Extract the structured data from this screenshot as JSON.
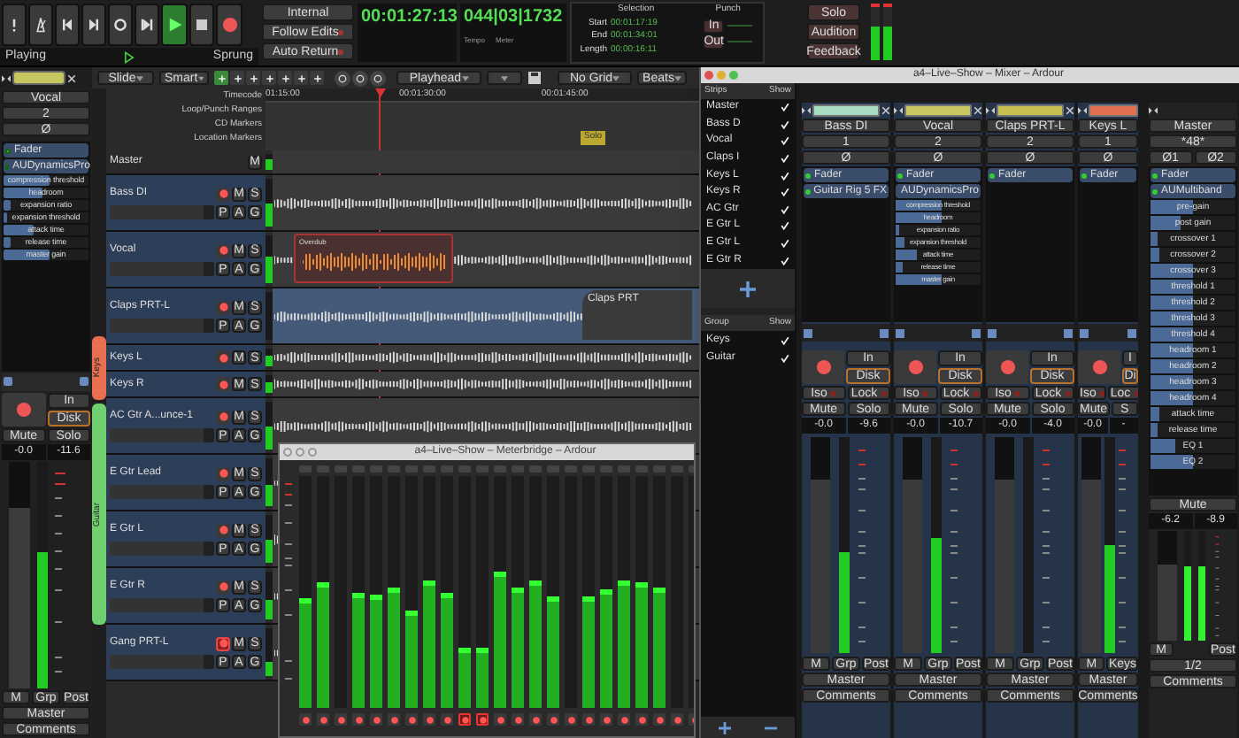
{
  "transport": {
    "state": "Playing",
    "mode": "Sprung",
    "sync_buttons": [
      "Internal",
      "Follow Edits",
      "Auto Return"
    ],
    "primary_clock": "00:01:27:13",
    "secondary_clock": "044|03|1732",
    "tempo_label": "Tempo",
    "meter_label": "Meter",
    "selection": {
      "title": "Selection",
      "rows": [
        {
          "label": "Start",
          "value": "00:01:17:19"
        },
        {
          "label": "End",
          "value": "00:01:34:01"
        },
        {
          "label": "Length",
          "value": "00:00:16:11"
        }
      ]
    },
    "punch": {
      "title": "Punch",
      "buttons": [
        "In",
        "Out"
      ]
    },
    "monitor_buttons": [
      "Solo",
      "Audition",
      "Feedback"
    ]
  },
  "toolbar": {
    "edit_mode": "Slide",
    "tool_mode": "Smart",
    "edit_point": "Playhead",
    "grid": "No Grid",
    "grid_type": "Beats"
  },
  "editor_strip": {
    "name": "Vocal",
    "color": "#c8c860",
    "input": "2",
    "phase": "Ø",
    "processors": [
      "Fader",
      "AUDynamicsPro"
    ],
    "params": [
      {
        "name": "compression threshold",
        "level": 0.55
      },
      {
        "name": "headroom",
        "level": 0.45
      },
      {
        "name": "expansion ratio",
        "level": 0.08
      },
      {
        "name": "expansion threshold",
        "level": 0.05
      },
      {
        "name": "attack time",
        "level": 0.35
      },
      {
        "name": "release time",
        "level": 0.08
      },
      {
        "name": "master gain",
        "level": 0.55
      }
    ],
    "in": "In",
    "disk": "Disk",
    "mute": "Mute",
    "solo": "Solo",
    "gain": "-0.0",
    "peak": "-11.6",
    "fader": {
      "level": 0.8
    },
    "meter": {
      "level": 0.6
    },
    "m": "M",
    "grp": "Grp",
    "post": "Post",
    "output": "Master",
    "comments": "Comments"
  },
  "group_tabs": [
    {
      "name": "Keys",
      "color": "#e87050"
    },
    {
      "name": "Guitar",
      "color": "#70d070"
    }
  ],
  "rulers": [
    "Timecode",
    "Loop/Punch Ranges",
    "CD Markers",
    "Location Markers"
  ],
  "ruler_times": [
    "01:15:00",
    "00:01:30:00",
    "00:01:45:00"
  ],
  "marker": "Solo",
  "tracks": [
    {
      "name": "Master",
      "kind": "master",
      "m": "M",
      "level": 0.7
    },
    {
      "name": "Bass DI",
      "kind": "tall",
      "level": 0.5,
      "rec_armed": false,
      "buttons": [
        "M",
        "S",
        "P",
        "A",
        "G"
      ]
    },
    {
      "name": "Vocal",
      "kind": "tall",
      "level": 0.55,
      "rec_armed": false,
      "buttons": [
        "M",
        "S",
        "P",
        "A",
        "G"
      ],
      "region": "Overdub"
    },
    {
      "name": "Claps PRT-L",
      "kind": "tall",
      "level": 0,
      "rec_armed": false,
      "buttons": [
        "M",
        "S",
        "P",
        "A",
        "G"
      ],
      "region": "Claps PRT"
    },
    {
      "name": "Keys L",
      "kind": "short",
      "level": 0.6,
      "rec_armed": false,
      "buttons": [
        "M",
        "S"
      ]
    },
    {
      "name": "Keys R",
      "kind": "short",
      "level": 0.6,
      "rec_armed": false,
      "buttons": [
        "M",
        "S"
      ]
    },
    {
      "name": "AC Gtr A...unce-1",
      "kind": "tall",
      "level": 0.5,
      "rec_armed": false,
      "buttons": [
        "M",
        "S",
        "P",
        "A",
        "G"
      ]
    },
    {
      "name": "E Gtr Lead",
      "kind": "tall",
      "level": 0.45,
      "rec_armed": false,
      "buttons": [
        "M",
        "S",
        "P",
        "A",
        "G"
      ]
    },
    {
      "name": "E Gtr L",
      "kind": "tall",
      "level": 0.5,
      "rec_armed": false,
      "buttons": [
        "M",
        "S",
        "P",
        "A",
        "G"
      ]
    },
    {
      "name": "E Gtr R",
      "kind": "tall",
      "level": 0.4,
      "rec_armed": false,
      "buttons": [
        "M",
        "S",
        "P",
        "A",
        "G"
      ]
    },
    {
      "name": "Gang PRT-L",
      "kind": "tall",
      "level": 0.3,
      "rec_armed": true,
      "buttons": [
        "M",
        "S",
        "P",
        "A",
        "G"
      ]
    }
  ],
  "mixer": {
    "title": "a4–Live–Show – Mixer – Ardour",
    "strips_header": [
      "Strips",
      "Show"
    ],
    "strip_list": [
      {
        "name": "Master",
        "checked": true
      },
      {
        "name": "Bass D",
        "checked": true
      },
      {
        "name": "Vocal",
        "checked": true
      },
      {
        "name": "Claps I",
        "checked": true
      },
      {
        "name": "Keys L",
        "checked": true
      },
      {
        "name": "Keys R",
        "checked": true
      },
      {
        "name": "AC Gtr",
        "checked": true
      },
      {
        "name": "E Gtr L",
        "checked": true
      },
      {
        "name": "E Gtr L",
        "checked": true
      },
      {
        "name": "E Gtr R",
        "checked": true
      }
    ],
    "group_header": [
      "Group",
      "Show"
    ],
    "groups": [
      {
        "name": "Keys",
        "checked": true
      },
      {
        "name": "Guitar",
        "checked": true
      }
    ],
    "strips": [
      {
        "name": "Bass DI",
        "color": "#a8dcc0",
        "input": "1",
        "phase": "Ø",
        "processors": [
          "Fader",
          "Guitar Rig 5 FX"
        ],
        "labels": {
          "in": "In",
          "disk": "Disk",
          "iso": "Iso",
          "lock": "Lock",
          "mute": "Mute",
          "solo": "Solo",
          "gain": "-0.0",
          "peak": "-9.6",
          "m": "M",
          "grp": "Grp",
          "post": "Post",
          "output": "Master",
          "comments": "Comments"
        },
        "fader": {
          "level": 0.8
        },
        "meter": {
          "level": 0.47
        }
      },
      {
        "name": "Vocal",
        "color": "#c8c860",
        "input": "2",
        "phase": "Ø",
        "processors": [
          "Fader",
          "AUDynamicsPro"
        ],
        "params": [
          {
            "name": "compression threshold",
            "level": 0.55
          },
          {
            "name": "headroom",
            "level": 0.55
          },
          {
            "name": "expansion ratio",
            "level": 0.05
          },
          {
            "name": "expansion threshold",
            "level": 0.1
          },
          {
            "name": "attack time",
            "level": 0.25
          },
          {
            "name": "release time",
            "level": 0.08
          },
          {
            "name": "master gain",
            "level": 0.55
          }
        ],
        "labels": {
          "in": "In",
          "disk": "Disk",
          "iso": "Iso",
          "lock": "Lock",
          "mute": "Mute",
          "solo": "Solo",
          "gain": "-0.0",
          "peak": "-10.7",
          "m": "M",
          "grp": "Grp",
          "post": "Post",
          "output": "Master",
          "comments": "Comments"
        },
        "fader": {
          "level": 0.8
        },
        "meter": {
          "level": 0.53
        }
      },
      {
        "name": "Claps PRT-L",
        "color": "#c8c050",
        "input": "2",
        "phase": "Ø",
        "processors": [
          "Fader"
        ],
        "labels": {
          "in": "In",
          "disk": "Disk",
          "iso": "Iso",
          "lock": "Lock",
          "mute": "Mute",
          "solo": "Solo",
          "gain": "-0.0",
          "peak": "-4.0",
          "m": "M",
          "grp": "Grp",
          "post": "Post",
          "output": "Master",
          "comments": "Comments"
        },
        "fader": {
          "level": 0.8
        },
        "meter": {
          "level": 0
        }
      },
      {
        "name": "Keys L",
        "color": "#e07050",
        "input": "1",
        "phase": "Ø",
        "processors": [
          "Fader"
        ],
        "labels": {
          "in": "I",
          "disk": "Di",
          "iso": "Iso",
          "lock": "Loc",
          "mute": "Mute",
          "solo": "S",
          "gain": "-0.0",
          "peak": "-",
          "m": "M",
          "grp": "Keys",
          "output": "Master",
          "comments": "Comments"
        },
        "fader": {
          "level": 0.8
        },
        "meter": {
          "level": 0.5
        }
      }
    ],
    "master": {
      "name": "Master",
      "input": "*48*",
      "phases": [
        "Ø1",
        "Ø2"
      ],
      "processors": [
        "Fader",
        "AUMultiband"
      ],
      "params": [
        {
          "name": "pre-gain",
          "level": 0.5
        },
        {
          "name": "post gain",
          "level": 0.35
        },
        {
          "name": "crossover 1",
          "level": 0.08
        },
        {
          "name": "crossover 2",
          "level": 0.1
        },
        {
          "name": "crossover 3",
          "level": 0.5
        },
        {
          "name": "threshold 1",
          "level": 0.5
        },
        {
          "name": "threshold 2",
          "level": 0.5
        },
        {
          "name": "threshold 3",
          "level": 0.5
        },
        {
          "name": "threshold 4",
          "level": 0.5
        },
        {
          "name": "headroom 1",
          "level": 0.5
        },
        {
          "name": "headroom 2",
          "level": 0.5
        },
        {
          "name": "headroom 3",
          "level": 0.5
        },
        {
          "name": "headroom 4",
          "level": 0.5
        },
        {
          "name": "attack time",
          "level": 0.1
        },
        {
          "name": "release time",
          "level": 0.08
        },
        {
          "name": "EQ 1",
          "level": 0.3
        },
        {
          "name": "EQ 2",
          "level": 0.5
        }
      ],
      "mute": "Mute",
      "gain": "-6.2",
      "peak": "-8.9",
      "m": "M",
      "post": "Post",
      "output": "1/2",
      "comments": "Comments",
      "fader": {
        "level": 0.7
      },
      "meters": [
        {
          "level": 0.68
        },
        {
          "level": 0.68
        }
      ]
    }
  },
  "meterbridge": {
    "title": "a4–Live–Show – Meterbridge – Ardour",
    "meters": [
      {
        "level": 0.47,
        "rec_armed": false
      },
      {
        "level": 0.54,
        "rec_armed": false
      },
      {
        "level": 0,
        "rec_armed": false
      },
      {
        "level": 0.5,
        "rec_armed": false
      },
      {
        "level": 0.49,
        "rec_armed": false
      },
      {
        "level": 0.52,
        "rec_armed": false
      },
      {
        "level": 0.42,
        "rec_armed": false
      },
      {
        "level": 0.55,
        "rec_armed": false
      },
      {
        "level": 0.5,
        "rec_armed": false
      },
      {
        "level": 0.26,
        "rec_armed": true
      },
      {
        "level": 0.26,
        "rec_armed": true
      },
      {
        "level": 0.59,
        "rec_armed": false
      },
      {
        "level": 0.52,
        "rec_armed": false
      },
      {
        "level": 0.55,
        "rec_armed": false
      },
      {
        "level": 0.48,
        "rec_armed": false
      },
      {
        "level": 0,
        "rec_armed": false
      },
      {
        "level": 0.48,
        "rec_armed": false
      },
      {
        "level": 0.51,
        "rec_armed": false
      },
      {
        "level": 0.55,
        "rec_armed": false
      },
      {
        "level": 0.54,
        "rec_armed": false
      },
      {
        "level": 0.52,
        "rec_armed": false
      },
      {
        "level": 0,
        "rec_armed": false
      },
      {
        "level": 0,
        "rec_armed": false
      }
    ]
  }
}
